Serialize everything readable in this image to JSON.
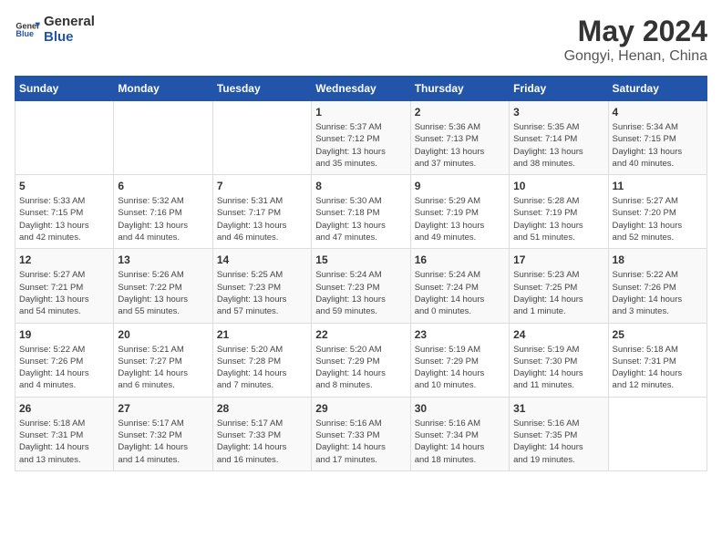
{
  "header": {
    "logo_general": "General",
    "logo_blue": "Blue",
    "title": "May 2024",
    "subtitle": "Gongyi, Henan, China"
  },
  "columns": [
    "Sunday",
    "Monday",
    "Tuesday",
    "Wednesday",
    "Thursday",
    "Friday",
    "Saturday"
  ],
  "weeks": [
    [
      {
        "day": "",
        "detail": ""
      },
      {
        "day": "",
        "detail": ""
      },
      {
        "day": "",
        "detail": ""
      },
      {
        "day": "1",
        "detail": "Sunrise: 5:37 AM\nSunset: 7:12 PM\nDaylight: 13 hours\nand 35 minutes."
      },
      {
        "day": "2",
        "detail": "Sunrise: 5:36 AM\nSunset: 7:13 PM\nDaylight: 13 hours\nand 37 minutes."
      },
      {
        "day": "3",
        "detail": "Sunrise: 5:35 AM\nSunset: 7:14 PM\nDaylight: 13 hours\nand 38 minutes."
      },
      {
        "day": "4",
        "detail": "Sunrise: 5:34 AM\nSunset: 7:15 PM\nDaylight: 13 hours\nand 40 minutes."
      }
    ],
    [
      {
        "day": "5",
        "detail": "Sunrise: 5:33 AM\nSunset: 7:15 PM\nDaylight: 13 hours\nand 42 minutes."
      },
      {
        "day": "6",
        "detail": "Sunrise: 5:32 AM\nSunset: 7:16 PM\nDaylight: 13 hours\nand 44 minutes."
      },
      {
        "day": "7",
        "detail": "Sunrise: 5:31 AM\nSunset: 7:17 PM\nDaylight: 13 hours\nand 46 minutes."
      },
      {
        "day": "8",
        "detail": "Sunrise: 5:30 AM\nSunset: 7:18 PM\nDaylight: 13 hours\nand 47 minutes."
      },
      {
        "day": "9",
        "detail": "Sunrise: 5:29 AM\nSunset: 7:19 PM\nDaylight: 13 hours\nand 49 minutes."
      },
      {
        "day": "10",
        "detail": "Sunrise: 5:28 AM\nSunset: 7:19 PM\nDaylight: 13 hours\nand 51 minutes."
      },
      {
        "day": "11",
        "detail": "Sunrise: 5:27 AM\nSunset: 7:20 PM\nDaylight: 13 hours\nand 52 minutes."
      }
    ],
    [
      {
        "day": "12",
        "detail": "Sunrise: 5:27 AM\nSunset: 7:21 PM\nDaylight: 13 hours\nand 54 minutes."
      },
      {
        "day": "13",
        "detail": "Sunrise: 5:26 AM\nSunset: 7:22 PM\nDaylight: 13 hours\nand 55 minutes."
      },
      {
        "day": "14",
        "detail": "Sunrise: 5:25 AM\nSunset: 7:23 PM\nDaylight: 13 hours\nand 57 minutes."
      },
      {
        "day": "15",
        "detail": "Sunrise: 5:24 AM\nSunset: 7:23 PM\nDaylight: 13 hours\nand 59 minutes."
      },
      {
        "day": "16",
        "detail": "Sunrise: 5:24 AM\nSunset: 7:24 PM\nDaylight: 14 hours\nand 0 minutes."
      },
      {
        "day": "17",
        "detail": "Sunrise: 5:23 AM\nSunset: 7:25 PM\nDaylight: 14 hours\nand 1 minute."
      },
      {
        "day": "18",
        "detail": "Sunrise: 5:22 AM\nSunset: 7:26 PM\nDaylight: 14 hours\nand 3 minutes."
      }
    ],
    [
      {
        "day": "19",
        "detail": "Sunrise: 5:22 AM\nSunset: 7:26 PM\nDaylight: 14 hours\nand 4 minutes."
      },
      {
        "day": "20",
        "detail": "Sunrise: 5:21 AM\nSunset: 7:27 PM\nDaylight: 14 hours\nand 6 minutes."
      },
      {
        "day": "21",
        "detail": "Sunrise: 5:20 AM\nSunset: 7:28 PM\nDaylight: 14 hours\nand 7 minutes."
      },
      {
        "day": "22",
        "detail": "Sunrise: 5:20 AM\nSunset: 7:29 PM\nDaylight: 14 hours\nand 8 minutes."
      },
      {
        "day": "23",
        "detail": "Sunrise: 5:19 AM\nSunset: 7:29 PM\nDaylight: 14 hours\nand 10 minutes."
      },
      {
        "day": "24",
        "detail": "Sunrise: 5:19 AM\nSunset: 7:30 PM\nDaylight: 14 hours\nand 11 minutes."
      },
      {
        "day": "25",
        "detail": "Sunrise: 5:18 AM\nSunset: 7:31 PM\nDaylight: 14 hours\nand 12 minutes."
      }
    ],
    [
      {
        "day": "26",
        "detail": "Sunrise: 5:18 AM\nSunset: 7:31 PM\nDaylight: 14 hours\nand 13 minutes."
      },
      {
        "day": "27",
        "detail": "Sunrise: 5:17 AM\nSunset: 7:32 PM\nDaylight: 14 hours\nand 14 minutes."
      },
      {
        "day": "28",
        "detail": "Sunrise: 5:17 AM\nSunset: 7:33 PM\nDaylight: 14 hours\nand 16 minutes."
      },
      {
        "day": "29",
        "detail": "Sunrise: 5:16 AM\nSunset: 7:33 PM\nDaylight: 14 hours\nand 17 minutes."
      },
      {
        "day": "30",
        "detail": "Sunrise: 5:16 AM\nSunset: 7:34 PM\nDaylight: 14 hours\nand 18 minutes."
      },
      {
        "day": "31",
        "detail": "Sunrise: 5:16 AM\nSunset: 7:35 PM\nDaylight: 14 hours\nand 19 minutes."
      },
      {
        "day": "",
        "detail": ""
      }
    ]
  ]
}
